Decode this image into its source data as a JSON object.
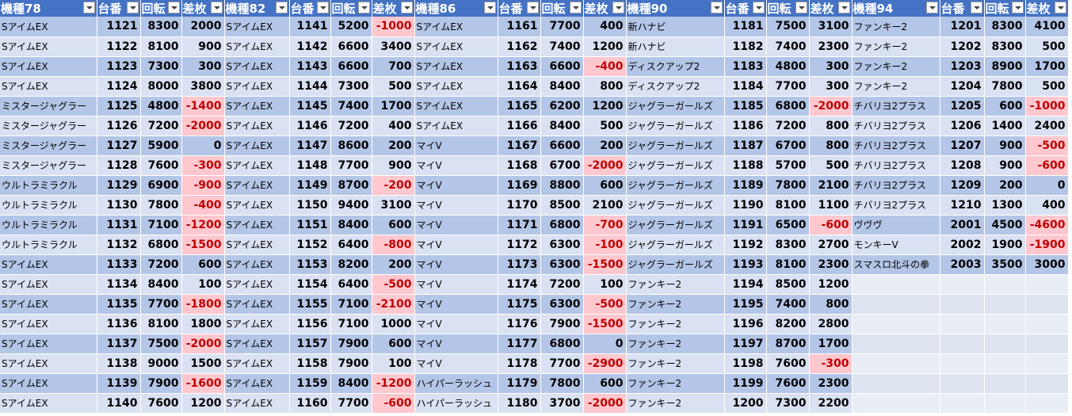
{
  "headers": [
    "機種78",
    "台番号",
    "回転数",
    "差枚数",
    "機種82",
    "台番号",
    "回転数",
    "差枚数",
    "機種86",
    "台番号",
    "回転数",
    "差枚数",
    "機種90",
    "台番号",
    "回転数",
    "差枚数",
    "機種94",
    "台番号",
    "回転数",
    "差枚数"
  ],
  "headers_visible": [
    "機種78",
    "台番",
    "回転",
    "差枚",
    "機種82",
    "台番",
    "回転",
    "差枚",
    "機種86",
    "台番",
    "回転",
    "差枚",
    "機種90",
    "台番",
    "回転",
    "差枚",
    "機種94",
    "台番",
    "回転",
    "差枚"
  ],
  "negative_highlight_color": "#ffc7ce",
  "negative_text_color": "#c00000",
  "header_color": "#4472c4",
  "rows": [
    [
      "SアイムEX",
      "1121",
      "8300",
      "2000",
      "SアイムEX",
      "1141",
      "5200",
      "-1000",
      "SアイムEX",
      "1161",
      "7700",
      "400",
      "新ハナビ",
      "1181",
      "7500",
      "3100",
      "ファンキー2",
      "1201",
      "8300",
      "4100"
    ],
    [
      "SアイムEX",
      "1122",
      "8100",
      "900",
      "SアイムEX",
      "1142",
      "6600",
      "3400",
      "SアイムEX",
      "1162",
      "7400",
      "1200",
      "新ハナビ",
      "1182",
      "7400",
      "2300",
      "ファンキー2",
      "1202",
      "8300",
      "500"
    ],
    [
      "SアイムEX",
      "1123",
      "7300",
      "300",
      "SアイムEX",
      "1143",
      "6600",
      "700",
      "SアイムEX",
      "1163",
      "6600",
      "-400",
      "ディスクアップ2",
      "1183",
      "4800",
      "300",
      "ファンキー2",
      "1203",
      "8900",
      "1700"
    ],
    [
      "SアイムEX",
      "1124",
      "8000",
      "3800",
      "SアイムEX",
      "1144",
      "7300",
      "500",
      "SアイムEX",
      "1164",
      "8400",
      "800",
      "ディスクアップ2",
      "1184",
      "7700",
      "300",
      "ファンキー2",
      "1204",
      "7800",
      "500"
    ],
    [
      "ミスタージャグラー",
      "1125",
      "4800",
      "-1400",
      "SアイムEX",
      "1145",
      "7400",
      "1700",
      "SアイムEX",
      "1165",
      "6200",
      "1200",
      "ジャグラーガールズ",
      "1185",
      "6800",
      "-2000",
      "チバリヨ2プラス",
      "1205",
      "600",
      "-1000"
    ],
    [
      "ミスタージャグラー",
      "1126",
      "7200",
      "-2000",
      "SアイムEX",
      "1146",
      "7200",
      "400",
      "SアイムEX",
      "1166",
      "8400",
      "500",
      "ジャグラーガールズ",
      "1186",
      "7200",
      "800",
      "チバリヨ2プラス",
      "1206",
      "1400",
      "2400"
    ],
    [
      "ミスタージャグラー",
      "1127",
      "5900",
      "0",
      "SアイムEX",
      "1147",
      "8600",
      "200",
      "マイV",
      "1167",
      "6600",
      "200",
      "ジャグラーガールズ",
      "1187",
      "6700",
      "800",
      "チバリヨ2プラス",
      "1207",
      "900",
      "-500"
    ],
    [
      "ミスタージャグラー",
      "1128",
      "7600",
      "-300",
      "SアイムEX",
      "1148",
      "7700",
      "900",
      "マイV",
      "1168",
      "6700",
      "-2000",
      "ジャグラーガールズ",
      "1188",
      "5700",
      "500",
      "チバリヨ2プラス",
      "1208",
      "900",
      "-600"
    ],
    [
      "ウルトラミラクル",
      "1129",
      "6900",
      "-900",
      "SアイムEX",
      "1149",
      "8700",
      "-200",
      "マイV",
      "1169",
      "8800",
      "600",
      "ジャグラーガールズ",
      "1189",
      "7800",
      "2100",
      "チバリヨ2プラス",
      "1209",
      "200",
      "0"
    ],
    [
      "ウルトラミラクル",
      "1130",
      "7800",
      "-400",
      "SアイムEX",
      "1150",
      "9400",
      "3100",
      "マイV",
      "1170",
      "8500",
      "2100",
      "ジャグラーガールズ",
      "1190",
      "8100",
      "1100",
      "チバリヨ2プラス",
      "1210",
      "1300",
      "400"
    ],
    [
      "ウルトラミラクル",
      "1131",
      "7100",
      "-1200",
      "SアイムEX",
      "1151",
      "8400",
      "600",
      "マイV",
      "1171",
      "6800",
      "-700",
      "ジャグラーガールズ",
      "1191",
      "6500",
      "-600",
      "ヴヴヴ",
      "2001",
      "4500",
      "-4600"
    ],
    [
      "ウルトラミラクル",
      "1132",
      "6800",
      "-1500",
      "SアイムEX",
      "1152",
      "6400",
      "-800",
      "マイV",
      "1172",
      "6300",
      "-100",
      "ジャグラーガールズ",
      "1192",
      "8300",
      "2700",
      "モンキーV",
      "2002",
      "1900",
      "-1900"
    ],
    [
      "SアイムEX",
      "1133",
      "7200",
      "600",
      "SアイムEX",
      "1153",
      "8200",
      "200",
      "マイV",
      "1173",
      "6300",
      "-1500",
      "ジャグラーガールズ",
      "1193",
      "8100",
      "2300",
      "スマスロ北斗の拳",
      "2003",
      "3500",
      "3000"
    ],
    [
      "SアイムEX",
      "1134",
      "8400",
      "100",
      "SアイムEX",
      "1154",
      "6400",
      "-500",
      "マイV",
      "1174",
      "7200",
      "100",
      "ファンキー2",
      "1194",
      "8500",
      "1200",
      "",
      "",
      "",
      ""
    ],
    [
      "SアイムEX",
      "1135",
      "7700",
      "-1800",
      "SアイムEX",
      "1155",
      "7100",
      "-2100",
      "マイV",
      "1175",
      "6300",
      "-500",
      "ファンキー2",
      "1195",
      "7400",
      "800",
      "",
      "",
      "",
      ""
    ],
    [
      "SアイムEX",
      "1136",
      "8100",
      "1800",
      "SアイムEX",
      "1156",
      "7100",
      "1000",
      "マイV",
      "1176",
      "7900",
      "-1500",
      "ファンキー2",
      "1196",
      "8200",
      "2800",
      "",
      "",
      "",
      ""
    ],
    [
      "SアイムEX",
      "1137",
      "7500",
      "-2000",
      "SアイムEX",
      "1157",
      "7900",
      "600",
      "マイV",
      "1177",
      "6800",
      "0",
      "ファンキー2",
      "1197",
      "8700",
      "1700",
      "",
      "",
      "",
      ""
    ],
    [
      "SアイムEX",
      "1138",
      "9000",
      "1500",
      "SアイムEX",
      "1158",
      "7900",
      "100",
      "マイV",
      "1178",
      "7700",
      "-2900",
      "ファンキー2",
      "1198",
      "7600",
      "-300",
      "",
      "",
      "",
      ""
    ],
    [
      "SアイムEX",
      "1139",
      "7900",
      "-1600",
      "SアイムEX",
      "1159",
      "8400",
      "-1200",
      "ハイパーラッシュ",
      "1179",
      "7800",
      "600",
      "ファンキー2",
      "1199",
      "7600",
      "2300",
      "",
      "",
      "",
      ""
    ],
    [
      "SアイムEX",
      "1140",
      "7600",
      "1200",
      "SアイムEX",
      "1160",
      "7700",
      "-600",
      "ハイパーラッシュ",
      "1180",
      "3700",
      "-2000",
      "ファンキー2",
      "1200",
      "7300",
      "2200",
      "",
      "",
      "",
      ""
    ]
  ]
}
